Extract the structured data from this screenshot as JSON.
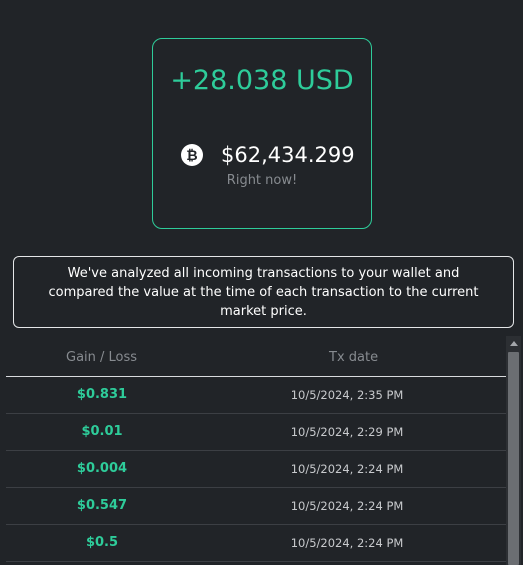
{
  "summary": {
    "total_gain": "+28.038 USD",
    "btc_price": "$62,434.299",
    "price_caption": "Right now!",
    "coin_icon": "bitcoin-icon",
    "accent_color": "#2ecc9a"
  },
  "info": {
    "message": "We've analyzed all incoming transactions to your wallet and compared the value at the time of each transaction to the current market price."
  },
  "table": {
    "headers": {
      "gain": "Gain / Loss",
      "date": "Tx date"
    },
    "rows": [
      {
        "gain": "$0.831",
        "date": "10/5/2024, 2:35 PM"
      },
      {
        "gain": "$0.01",
        "date": "10/5/2024, 2:29 PM"
      },
      {
        "gain": "$0.004",
        "date": "10/5/2024, 2:24 PM"
      },
      {
        "gain": "$0.547",
        "date": "10/5/2024, 2:24 PM"
      },
      {
        "gain": "$0.5",
        "date": "10/5/2024, 2:24 PM"
      }
    ]
  }
}
